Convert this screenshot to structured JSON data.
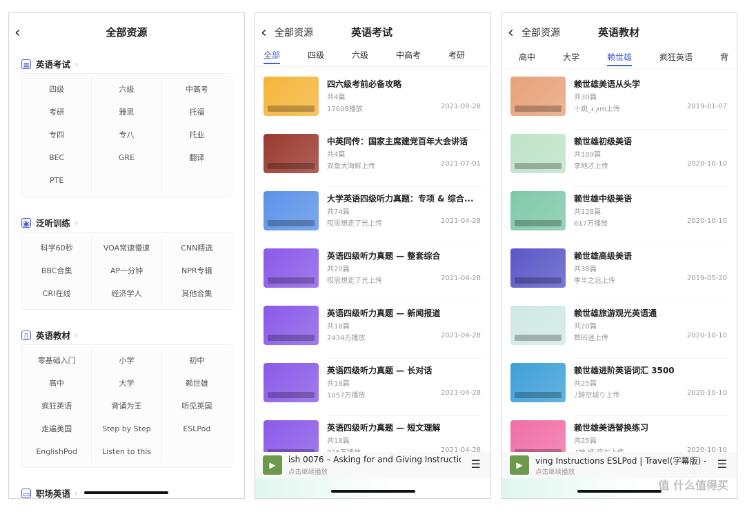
{
  "panel1": {
    "title": "全部资源",
    "sections": [
      {
        "title": "英语考试",
        "icon": "exam-icon",
        "items": [
          "四级",
          "六级",
          "中高考",
          "考研",
          "雅思",
          "托福",
          "专四",
          "专八",
          "托业",
          "BEC",
          "GRE",
          "翻译",
          "PTE"
        ]
      },
      {
        "title": "泛听训练",
        "icon": "headphone-globe-icon",
        "items": [
          "科学60秒",
          "VOA常速慢速",
          "CNN精选",
          "BBC合集",
          "AP一分钟",
          "NPR专辑",
          "CRI在线",
          "经济学人",
          "其他合集"
        ]
      },
      {
        "title": "英语教材",
        "icon": "book-icon",
        "items": [
          "零基础入门",
          "小学",
          "初中",
          "高中",
          "大学",
          "赖世雄",
          "疯狂英语",
          "背诵为王",
          "听见英国",
          "走遍美国",
          "Step by Step",
          "ESLPod",
          "EnglishPod",
          "Listen to this"
        ]
      },
      {
        "title": "职场英语",
        "icon": "briefcase-icon",
        "items": []
      }
    ]
  },
  "panel2": {
    "back_label": "全部资源",
    "title": "英语考试",
    "tabs": [
      "全部",
      "四级",
      "六级",
      "中高考",
      "考研"
    ],
    "active_tab": 0,
    "items": [
      {
        "title": "四六级考前必备攻略",
        "count": "共4篇",
        "meta": "17608播放",
        "date": "2021-09-28",
        "color": "#f5b53a"
      },
      {
        "title": "中英同传：国家主席建党百年大会讲话",
        "count": "共4篇",
        "meta": "双鱼大海鲜上传",
        "date": "2021-07-01",
        "color": "#9a3a2e"
      },
      {
        "title": "大学英语四级听力真题：专项 & 综合...",
        "count": "共74篇",
        "meta": "哎思想走了光上传",
        "date": "2021-04-28",
        "color": "#5b93e8"
      },
      {
        "title": "英语四级听力真题 — 整套综合",
        "count": "共20篇",
        "meta": "哎思想走了光上传",
        "date": "2021-04-28",
        "color": "#8a5ae8"
      },
      {
        "title": "英语四级听力真题 — 新闻报道",
        "count": "共18篇",
        "meta": "2434万播放",
        "date": "2021-04-28",
        "color": "#8a5ae8"
      },
      {
        "title": "英语四级听力真题 — 长对话",
        "count": "共18篇",
        "meta": "1057万播放",
        "date": "2021-04-28",
        "color": "#8a5ae8"
      },
      {
        "title": "英语四级听力真题 — 短文理解",
        "count": "共18篇",
        "meta": "925万播放",
        "date": "2021-04-28",
        "color": "#8a5ae8"
      }
    ],
    "player": {
      "thumb": "Travel",
      "text": "ish 0076 – Asking for and Giving Instructio",
      "sub": "点击继续播放"
    }
  },
  "panel3": {
    "back_label": "全部资源",
    "title": "英语教材",
    "tabs": [
      "高中",
      "大学",
      "赖世雄",
      "疯狂英语",
      "背"
    ],
    "active_tab": 2,
    "items": [
      {
        "title": "赖世雄美语从头学",
        "count": "共30篇",
        "meta": "十跳_ᵻ ꭗm上传",
        "date": "2019-01-07",
        "color": "#e8a27a"
      },
      {
        "title": "赖世雄初级美语",
        "count": "共109篇",
        "meta": "李地才上传",
        "date": "2020-10-10",
        "color": "#bfe3c8"
      },
      {
        "title": "赖世雄中级美语",
        "count": "共128篇",
        "meta": "617万播放",
        "date": "2020-10-10",
        "color": "#7fc9a8"
      },
      {
        "title": "赖世雄高级美语",
        "count": "共38篇",
        "meta": "季半之远上传",
        "date": "2019-05-20",
        "color": "#5a57c8"
      },
      {
        "title": "赖世雄旅游观光英语通",
        "count": "共20篇",
        "meta": "数码迷上传",
        "date": "2020-10-10",
        "color": "#cfe9e6"
      },
      {
        "title": "赖世雄进阶英语词汇 3500",
        "count": "共25篇",
        "meta": "♪醉空城り上传",
        "date": "2020-10-10",
        "color": "#3ea0d8"
      },
      {
        "title": "赖世雄美语替换练习",
        "count": "共25篇",
        "meta": "♪神 经 病右上传",
        "date": "2020-10-10",
        "color": "#f06fa6"
      }
    ],
    "player": {
      "thumb": "Travel",
      "text": "ving Instructions   ESLPod | Travel(字幕版) -",
      "sub": "点击继续播放"
    }
  },
  "accent": "#4a5bd4",
  "watermark": "值 什么值得买 SMYZ.NET"
}
